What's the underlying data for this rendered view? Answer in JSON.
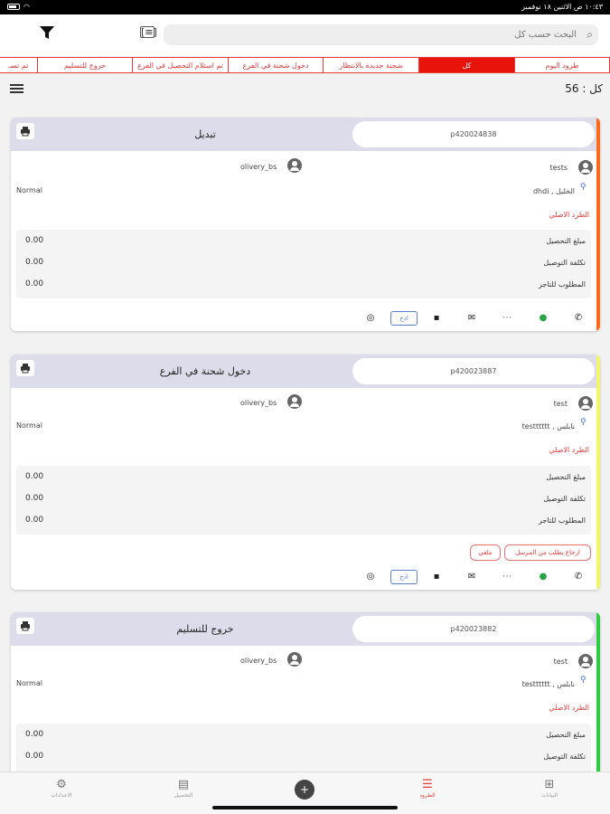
{
  "status_bar": {
    "time_date": "١٠:٤٣ ص   الاثنين ١٨ نوفمبر",
    "icons": [
      "battery-icon",
      "wifi-icon"
    ]
  },
  "header": {
    "search_placeholder": "البحث حسب كل",
    "scan_label": "[≡]"
  },
  "tabs": [
    {
      "label": "طرود اليوم",
      "active": false
    },
    {
      "label": "كل",
      "active": true
    },
    {
      "label": "شحنة جديدة بالانتظار",
      "active": false
    },
    {
      "label": "دخول شحنة في الفرع",
      "active": false
    },
    {
      "label": "تم استلام التحصيل في الفرع",
      "active": false
    },
    {
      "label": "خروج للتسليم",
      "active": false
    },
    {
      "label": "تم تسـ",
      "active": false
    }
  ],
  "count_label": "كل : 56",
  "cards": [
    {
      "tracking": "p420024838",
      "status": "تبديل",
      "stripe_color": "#ff6b1a",
      "customer": "tests",
      "driver": "olivery_bs",
      "location": "الخليل , dhdi",
      "priority": "Normal",
      "parcel_type": "الطرد الاصلي",
      "amounts": [
        {
          "label": "مبلغ التحصيل",
          "value": "0.00"
        },
        {
          "label": "تكلفة التوصيل",
          "value": "0.00"
        },
        {
          "label": "المطلوب للتاجر",
          "value": "0.00"
        }
      ],
      "edit_label": "ادخ",
      "buttons": []
    },
    {
      "tracking": "p420023887",
      "status": "دخول شحنة في الفرع",
      "stripe_color": "#f5f56a",
      "customer": "test",
      "driver": "olivery_bs",
      "location": "نابلس , testttttt",
      "priority": "Normal",
      "parcel_type": "الطرد الاصلي",
      "amounts": [
        {
          "label": "مبلغ التحصيل",
          "value": "0.00"
        },
        {
          "label": "تكلفة التوصيل",
          "value": "0.00"
        },
        {
          "label": "المطلوب للتاجر",
          "value": "0.00"
        }
      ],
      "edit_label": "ادخ",
      "buttons": [
        "ارجاع بطلب من المرسل",
        "ملغي"
      ]
    },
    {
      "tracking": "p420023882",
      "status": "خروج للتسليم",
      "stripe_color": "#2ecc40",
      "customer": "test",
      "driver": "olivery_bs",
      "location": "نابلس , testttttt",
      "priority": "Normal",
      "parcel_type": "الطرد الاصلي",
      "amounts": [
        {
          "label": "مبلغ التحصيل",
          "value": "0.00"
        },
        {
          "label": "تكلفة التوصيل",
          "value": "0.00"
        }
      ],
      "edit_label": "",
      "buttons": []
    }
  ],
  "bottom_nav": [
    {
      "label": "البيانات",
      "icon": "grid-icon",
      "active": false
    },
    {
      "label": "الطرود",
      "icon": "list-icon",
      "active": true
    },
    {
      "label": "",
      "icon": "add-icon",
      "active": false
    },
    {
      "label": "التحصيل",
      "icon": "document-icon",
      "active": false
    },
    {
      "label": "الاعدادات",
      "icon": "gear-icon",
      "active": false
    }
  ]
}
